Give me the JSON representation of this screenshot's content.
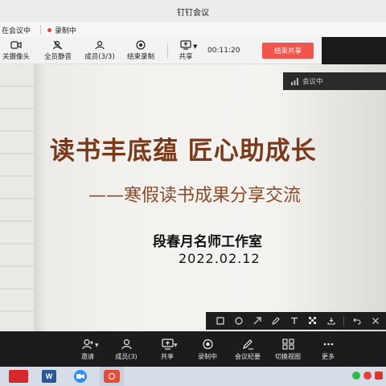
{
  "window": {
    "title": "钉钉会议"
  },
  "status": {
    "in_meeting": "在会议中",
    "recording": "录制中"
  },
  "top_toolbar": {
    "buttons": [
      "关摄像头",
      "全员静音",
      "成员(3/3)",
      "结束录制",
      "共享"
    ],
    "timer": "00:11:20",
    "end_share": "结束共享"
  },
  "slide": {
    "title": "读书丰底蕴  匠心助成长",
    "subtitle": "——寒假读书成果分享交流",
    "studio": "段春月名师工作室",
    "date": "2022.02.12"
  },
  "meeting_badge": {
    "label": "会议中"
  },
  "annotation_tools": [
    "square-icon",
    "circle-icon",
    "arrow-icon",
    "pen-icon",
    "text-icon",
    "mosaic-icon",
    "save-icon",
    "undo-icon",
    "close-icon"
  ],
  "bottom_toolbar": {
    "buttons": [
      "邀请",
      "成员(3)",
      "共享",
      "录制中",
      "会议纪要",
      "切换视图",
      "更多"
    ]
  },
  "taskbar": {
    "apps": [
      "app-red-icon",
      "word-icon",
      "video-call-icon",
      "camera-app-icon"
    ],
    "tray_icons": [
      "wechat-icon",
      "recording-icon",
      "app-tray-icon"
    ]
  },
  "colors": {
    "title_brown": "#7a3a1a",
    "end_share_red": "#f0564b",
    "recording_red": "#e43f3f",
    "dark_toolbar": "#1c1c1c"
  }
}
